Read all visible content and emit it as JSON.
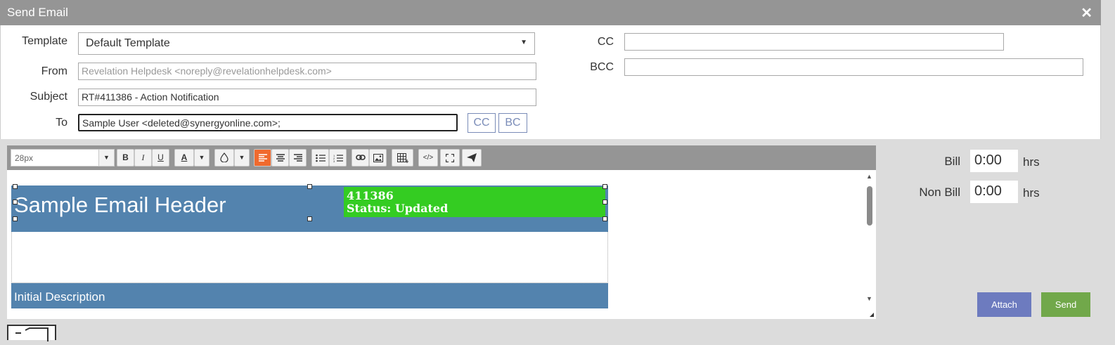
{
  "window": {
    "title": "Send Email",
    "close_label": "✕"
  },
  "form": {
    "template_label": "Template",
    "template_value": "Default Template",
    "from_label": "From",
    "from_value": "Revelation Helpdesk <noreply@revelationhelpdesk.com>",
    "subject_label": "Subject",
    "subject_value": "RT#411386 - Action Notification",
    "to_label": "To",
    "to_value": "Sample User <deleted@synergyonline.com>;",
    "cc_button": "CC",
    "bc_button": "BC",
    "cc_label": "CC",
    "cc_value": "",
    "bcc_label": "BCC",
    "bcc_value": ""
  },
  "toolbar": {
    "font_size": "28px",
    "bold": "B",
    "italic": "I",
    "underline": "U",
    "font_color": "A"
  },
  "email_body": {
    "header_title": "Sample Email Header",
    "ticket_number": "411386",
    "status": "Status: Updated",
    "section_title": "Initial Description"
  },
  "time": {
    "bill_label": "Bill",
    "bill_value": "0:00",
    "bill_unit": "hrs",
    "nonbill_label": "Non Bill",
    "nonbill_value": "0:00",
    "nonbill_unit": "hrs"
  },
  "actions": {
    "attach": "Attach",
    "send": "Send"
  },
  "colors": {
    "attach": "#6d7bbf",
    "send": "#71a84a",
    "header_blue": "#5383ae",
    "status_green": "#34cc22",
    "active_align": "#f06a2e"
  }
}
